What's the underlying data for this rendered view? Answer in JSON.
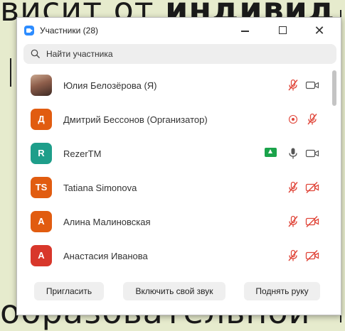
{
  "background": {
    "top_text_plain": "висит от ",
    "top_text_bold": "индивид",
    "bottom_text": "образовательной"
  },
  "window": {
    "title": "Участники (28)",
    "controls": {
      "minimize": "—",
      "maximize": "□",
      "close": "✕"
    }
  },
  "search": {
    "placeholder": "Найти участника",
    "value": ""
  },
  "participants": [
    {
      "name": "Юлия Белозёрова (Я)",
      "avatar_initials": "",
      "avatar_color": "photo",
      "host": false,
      "mic": "muted",
      "video": "on"
    },
    {
      "name": "Дмитрий Бессонов (Организатор)",
      "avatar_initials": "Д",
      "avatar_color": "#e15c10",
      "host": false,
      "recording": true,
      "mic": "muted",
      "video": "none"
    },
    {
      "name": "RezerTM",
      "avatar_initials": "R",
      "avatar_color": "#1e9e8a",
      "host": true,
      "mic": "on",
      "video": "on"
    },
    {
      "name": "Tatiana Simonova",
      "avatar_initials": "TS",
      "avatar_color": "#e15c10",
      "host": false,
      "mic": "muted",
      "video": "off"
    },
    {
      "name": "Алина Малиновская",
      "avatar_initials": "А",
      "avatar_color": "#e15c10",
      "host": false,
      "mic": "muted",
      "video": "off"
    },
    {
      "name": "Анастасия Иванова",
      "avatar_initials": "А",
      "avatar_color": "#d8372b",
      "host": false,
      "mic": "muted",
      "video": "off"
    }
  ],
  "footer": {
    "invite_label": "Пригласить",
    "unmute_label": "Включить свой звук",
    "raise_hand_label": "Поднять руку"
  },
  "colors": {
    "muted": "#e0463a",
    "icon_gray": "#555555",
    "accent": "#2d8cff"
  }
}
